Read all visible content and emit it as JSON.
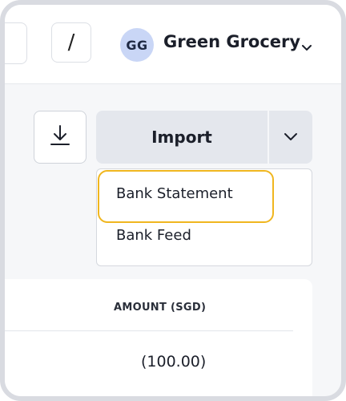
{
  "header": {
    "slash_label": "/",
    "org": {
      "initials": "GG",
      "name": "Green Grocery"
    }
  },
  "actions": {
    "download_icon": "download-icon",
    "import_label": "Import",
    "caret_icon": "chevron-down-icon"
  },
  "import_menu": {
    "items": [
      {
        "label": "Bank Statement",
        "focused": true
      },
      {
        "label": "Bank Feed",
        "focused": false
      }
    ]
  },
  "table": {
    "columns": [
      "AMOUNT (SGD)"
    ],
    "rows": [
      {
        "amount": "(100.00)"
      }
    ]
  },
  "colors": {
    "focus_ring": "#f0b61f",
    "avatar_bg": "#c9d6f6",
    "button_bg": "#e4e7ed"
  }
}
